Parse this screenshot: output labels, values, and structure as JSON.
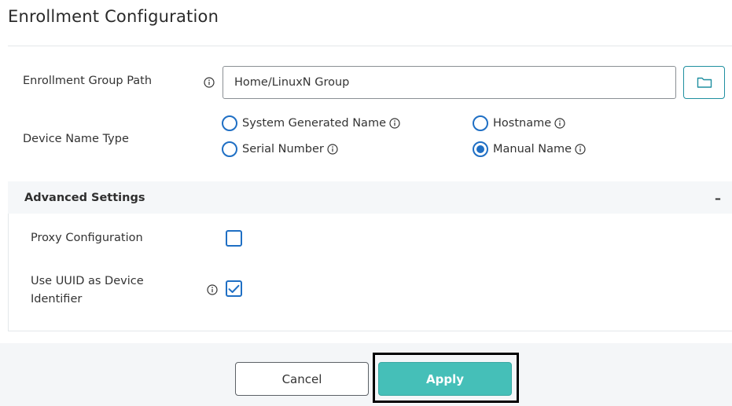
{
  "page": {
    "title": "Enrollment Configuration"
  },
  "enrollment": {
    "group_path_label": "Enrollment Group Path",
    "group_path_value": "Home/LinuxN Group",
    "browse_icon": "folder-icon"
  },
  "device_name": {
    "label": "Device Name Type",
    "options": [
      {
        "label": "System Generated Name",
        "checked": false
      },
      {
        "label": "Hostname",
        "checked": false
      },
      {
        "label": "Serial Number",
        "checked": false
      },
      {
        "label": "Manual Name",
        "checked": true
      }
    ]
  },
  "advanced": {
    "title": "Advanced Settings",
    "toggle": "–",
    "proxy_label": "Proxy Configuration",
    "proxy_checked": false,
    "uuid_label": "Use UUID as Device Identifier",
    "uuid_checked": true
  },
  "footer": {
    "cancel_label": "Cancel",
    "apply_label": "Apply"
  },
  "colors": {
    "accent_blue": "#1f6fc4",
    "apply_teal": "#45bfb8",
    "folder_border": "#1f8fa0"
  }
}
